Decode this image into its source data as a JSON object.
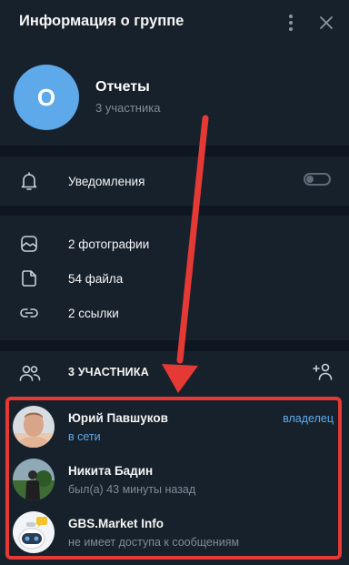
{
  "header": {
    "title": "Информация о группе"
  },
  "group": {
    "avatar_letter": "О",
    "name": "Отчеты",
    "members_count": "3 участника"
  },
  "notifications": {
    "label": "Уведомления",
    "enabled": false
  },
  "media": [
    {
      "icon": "image-icon",
      "label": "2 фотографии"
    },
    {
      "icon": "file-icon",
      "label": "54 файла"
    },
    {
      "icon": "link-icon",
      "label": "2 ссылки"
    }
  ],
  "members": {
    "title": "3 УЧАСТНИКА",
    "list": [
      {
        "name": "Юрий Павшуков",
        "status": "в сети",
        "role": "владелец"
      },
      {
        "name": "Никита Бадин",
        "status": "был(а) 43 минуты назад",
        "role": ""
      },
      {
        "name": "GBS.Market Info",
        "status": "не имеет доступа к сообщениям",
        "role": ""
      }
    ]
  },
  "colors": {
    "background": "#17212b",
    "accent": "#5ea9e9",
    "highlight": "#e53935"
  }
}
